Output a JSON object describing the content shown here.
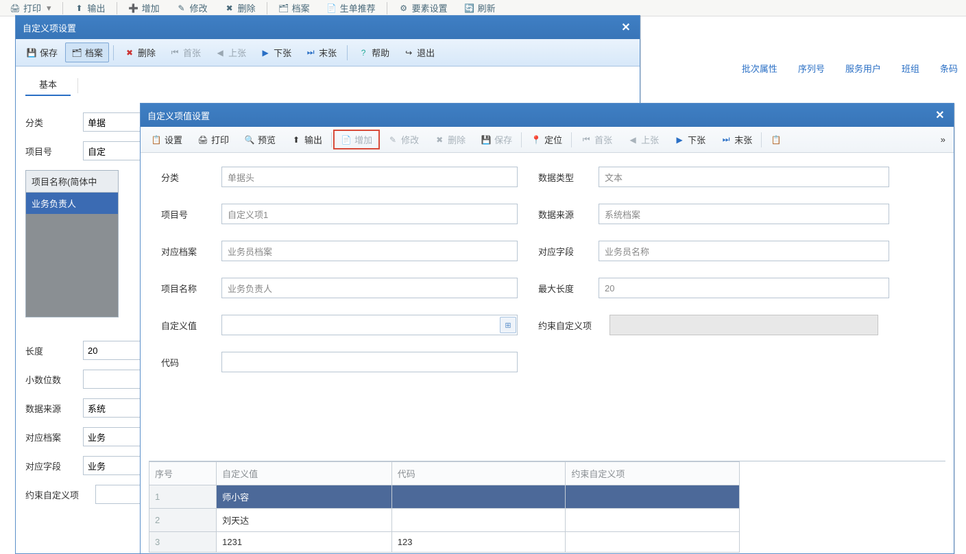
{
  "main_toolbar": {
    "print": "打印",
    "export": "输出",
    "add": "增加",
    "modify": "修改",
    "delete": "删除",
    "archive": "档案",
    "gen": "生单推荐",
    "setting": "要素设置",
    "refresh": "刷新"
  },
  "tab_links": {
    "batch": "批次属性",
    "serial": "序列号",
    "user": "服务用户",
    "team": "班组",
    "barcode": "条码"
  },
  "dialog1": {
    "title": "自定义项设置",
    "toolbar": {
      "save": "保存",
      "archive": "档案",
      "delete": "删除",
      "first": "首张",
      "prev": "上张",
      "next": "下张",
      "last": "末张",
      "help": "帮助",
      "exit": "退出"
    },
    "tab_basic": "基本",
    "form": {
      "fenlei_label": "分类",
      "fenlei_value": "单据",
      "xiangmuhao_label": "项目号",
      "xiangmuhao_value": "自定",
      "grid_header": "项目名称(简体中",
      "grid_row1": "业务负责人",
      "changdu_label": "长度",
      "changdu_value": "20",
      "xiaoshu_label": "小数位数",
      "xiaoshu_value": "",
      "shujulaiyuan_label": "数据来源",
      "shujulaiyuan_value": "系统",
      "duiyingdangan_label": "对应档案",
      "duiyingdangan_value": "业务",
      "duiyingziduan_label": "对应字段",
      "duiyingziduan_value": "业务",
      "yueshu_label": "约束自定义项"
    }
  },
  "dialog2": {
    "title": "自定义项值设置",
    "toolbar": {
      "settings": "设置",
      "print": "打印",
      "preview": "预览",
      "export": "输出",
      "add": "增加",
      "modify": "修改",
      "delete": "删除",
      "save": "保存",
      "locate": "定位",
      "first": "首张",
      "prev": "上张",
      "next": "下张",
      "last": "末张"
    },
    "form": {
      "fenlei_label": "分类",
      "fenlei_value": "单据头",
      "shujuleixing_label": "数据类型",
      "shujuleixing_value": "文本",
      "xiangmuhao_label": "项目号",
      "xiangmuhao_value": "自定义项1",
      "shujulaiyuan_label": "数据来源",
      "shujulaiyuan_value": "系统档案",
      "duiyingdangan_label": "对应档案",
      "duiyingdangan_value": "业务员档案",
      "duiyingziduan_label": "对应字段",
      "duiyingziduan_value": "业务员名称",
      "xiangmumingcheng_label": "项目名称",
      "xiangmumingcheng_value": "业务负责人",
      "zuidachangdu_label": "最大长度",
      "zuidachangdu_value": "20",
      "zidingyi_label": "自定义值",
      "zidingyi_value": "",
      "yueshu_label": "约束自定义项",
      "yueshu_value": "",
      "daima_label": "代码",
      "daima_value": ""
    },
    "grid": {
      "headers": {
        "seq": "序号",
        "val": "自定义值",
        "code": "代码",
        "cons": "约束自定义项"
      },
      "rows": [
        {
          "seq": "1",
          "val": "师小容",
          "code": "",
          "cons": ""
        },
        {
          "seq": "2",
          "val": "刘天达",
          "code": "",
          "cons": ""
        },
        {
          "seq": "3",
          "val": "1231",
          "code": "123",
          "cons": ""
        }
      ]
    }
  }
}
